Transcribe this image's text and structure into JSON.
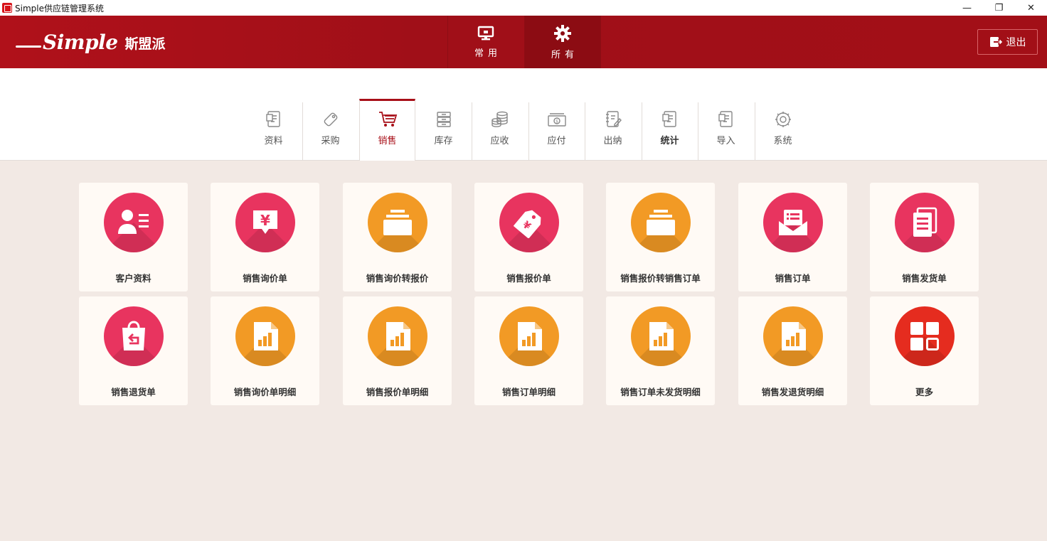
{
  "window": {
    "title": "Simple供应链管理系统",
    "controls": [
      "—",
      "❐",
      "✕"
    ]
  },
  "header": {
    "logo_word": "Simple",
    "logo_cn": "斯盟派",
    "tabs": [
      {
        "label": "常用",
        "icon": "monitor-icon"
      },
      {
        "label": "所有",
        "icon": "gear-icon"
      }
    ],
    "exit_label": "退出"
  },
  "modules": [
    {
      "label": "资料",
      "icon": "document-icon"
    },
    {
      "label": "采购",
      "icon": "tag-icon"
    },
    {
      "label": "销售",
      "icon": "cart-icon"
    },
    {
      "label": "库存",
      "icon": "stack-icon"
    },
    {
      "label": "应收",
      "icon": "coins-icon"
    },
    {
      "label": "应付",
      "icon": "cash-icon"
    },
    {
      "label": "出纳",
      "icon": "notebook-icon"
    },
    {
      "label": "统计",
      "icon": "document-icon"
    },
    {
      "label": "导入",
      "icon": "document-icon"
    },
    {
      "label": "系统",
      "icon": "settings-icon"
    }
  ],
  "active_module": "销售",
  "grid": [
    {
      "label": "客户资料",
      "icon": "contact-card-icon",
      "color": "#e8345f"
    },
    {
      "label": "销售询价单",
      "icon": "price-bubble-icon",
      "color": "#e8345f"
    },
    {
      "label": "销售询价转报价",
      "icon": "folder-tray-icon",
      "color": "#f29a25"
    },
    {
      "label": "销售报价单",
      "icon": "price-tag-icon",
      "color": "#e8345f"
    },
    {
      "label": "销售报价转销售订单",
      "icon": "folder-tray-icon",
      "color": "#f29a25"
    },
    {
      "label": "销售订单",
      "icon": "envelope-list-icon",
      "color": "#e8345f"
    },
    {
      "label": "销售发货单",
      "icon": "documents-icon",
      "color": "#e8345f"
    },
    {
      "label": "销售退货单",
      "icon": "return-bag-icon",
      "color": "#e8345f"
    },
    {
      "label": "销售询价单明细",
      "icon": "bar-report-icon",
      "color": "#f29a25"
    },
    {
      "label": "销售报价单明细",
      "icon": "bar-report-icon",
      "color": "#f29a25"
    },
    {
      "label": "销售订单明细",
      "icon": "bar-report-icon",
      "color": "#f29a25"
    },
    {
      "label": "销售订单未发货明细",
      "icon": "bar-report-icon",
      "color": "#f29a25"
    },
    {
      "label": "销售发退货明细",
      "icon": "bar-report-icon",
      "color": "#f29a25"
    },
    {
      "label": "更多",
      "icon": "grid-more-icon",
      "color": "#e52c1f"
    }
  ]
}
